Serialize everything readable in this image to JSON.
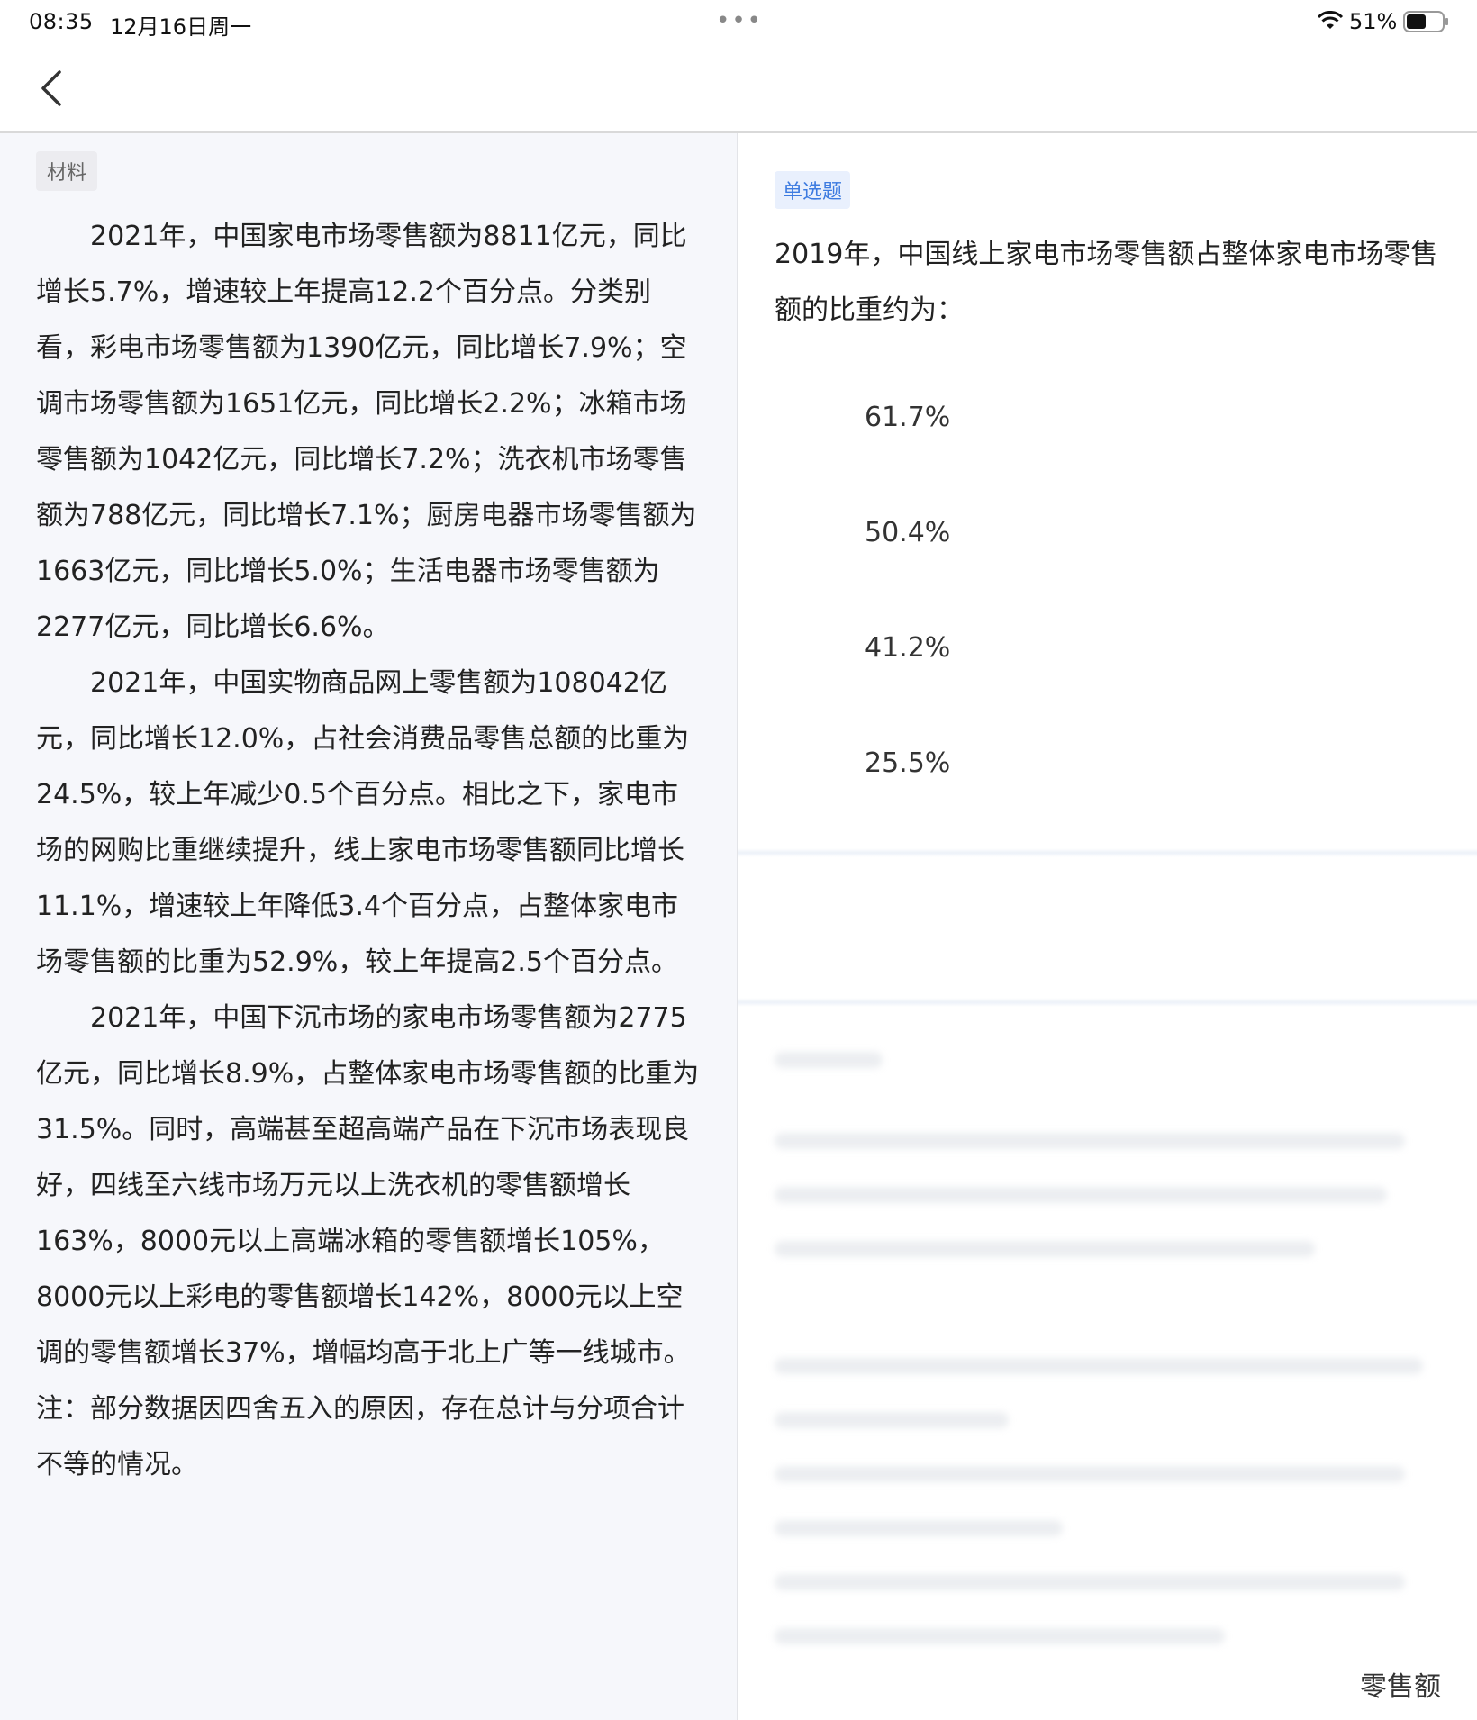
{
  "status_bar": {
    "time": "08:35",
    "date": "12月16日周一",
    "battery": "51%"
  },
  "material": {
    "tag": "材料",
    "paragraphs": [
      "2021年，中国家电市场零售额为8811亿元，同比增长5.7%，增速较上年提高12.2个百分点。分类别看，彩电市场零售额为1390亿元，同比增长7.9%；空调市场零售额为1651亿元，同比增长2.2%；冰箱市场零售额为1042亿元，同比增长7.2%；洗衣机市场零售额为788亿元，同比增长7.1%；厨房电器市场零售额为1663亿元，同比增长5.0%；生活电器市场零售额为2277亿元，同比增长6.6%。",
      "2021年，中国实物商品网上零售额为108042亿元，同比增长12.0%，占社会消费品零售总额的比重为24.5%，较上年减少0.5个百分点。相比之下，家电市场的网购比重继续提升，线上家电市场零售额同比增长11.1%，增速较上年降低3.4个百分点，占整体家电市场零售额的比重为52.9%，较上年提高2.5个百分点。",
      "2021年，中国下沉市场的家电市场零售额为2775亿元，同比增长8.9%，占整体家电市场零售额的比重为31.5%。同时，高端甚至超高端产品在下沉市场表现良好，四线至六线市场万元以上洗衣机的零售额增长163%，8000元以上高端冰箱的零售额增长105%，8000元以上彩电的零售额增长142%，8000元以上空调的零售额增长37%，增幅均高于北上广等一线城市。"
    ],
    "note": "注：部分数据因四舍五入的原因，存在总计与分项合计不等的情况。"
  },
  "question": {
    "type_tag": "单选题",
    "stem": "2019年，中国线上家电市场零售额占整体家电市场零售额的比重约为：",
    "options": [
      "61.7%",
      "50.4%",
      "41.2%",
      "25.5%"
    ]
  },
  "analysis_fragment": "零售额"
}
